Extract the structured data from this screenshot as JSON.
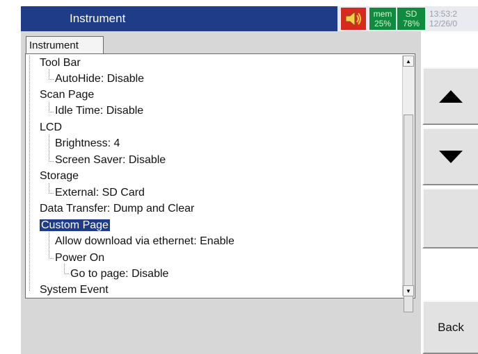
{
  "header": {
    "title": "Instrument",
    "speaker_icon": "speaker-icon",
    "mem_label": "mem",
    "mem_value": "25%",
    "sd_label": "SD",
    "sd_value": "78%",
    "time": "13:53:2",
    "date": "12/26/0"
  },
  "tab": {
    "label": "Instrument"
  },
  "tree": {
    "items": [
      {
        "label": "Tool Bar",
        "level": 0
      },
      {
        "label": "AutoHide: Disable",
        "level": 1
      },
      {
        "label": "Scan Page",
        "level": 0
      },
      {
        "label": "Idle Time: Disable",
        "level": 1
      },
      {
        "label": "LCD",
        "level": 0
      },
      {
        "label": "Brightness: 4",
        "level": 1
      },
      {
        "label": "Screen Saver: Disable",
        "level": 1
      },
      {
        "label": "Storage",
        "level": 0
      },
      {
        "label": "External: SD Card",
        "level": 1
      },
      {
        "label": "Data Transfer: Dump and Clear",
        "level": 0
      },
      {
        "label": "Custom Page",
        "level": 0,
        "selected": true
      },
      {
        "label": "Allow download via ethernet: Enable",
        "level": 1
      },
      {
        "label": "Power On",
        "level": 1
      },
      {
        "label": "Go to page: Disable",
        "level": 2
      },
      {
        "label": "System Event",
        "level": 0
      }
    ]
  },
  "side": {
    "up_icon": "arrow-up-icon",
    "down_icon": "arrow-down-icon",
    "back_label": "Back"
  },
  "colors": {
    "title_bg": "#1f3c88",
    "selection": "#1f3c88",
    "status_green": "#0f8a3e",
    "speaker_red": "#d62a1e"
  }
}
